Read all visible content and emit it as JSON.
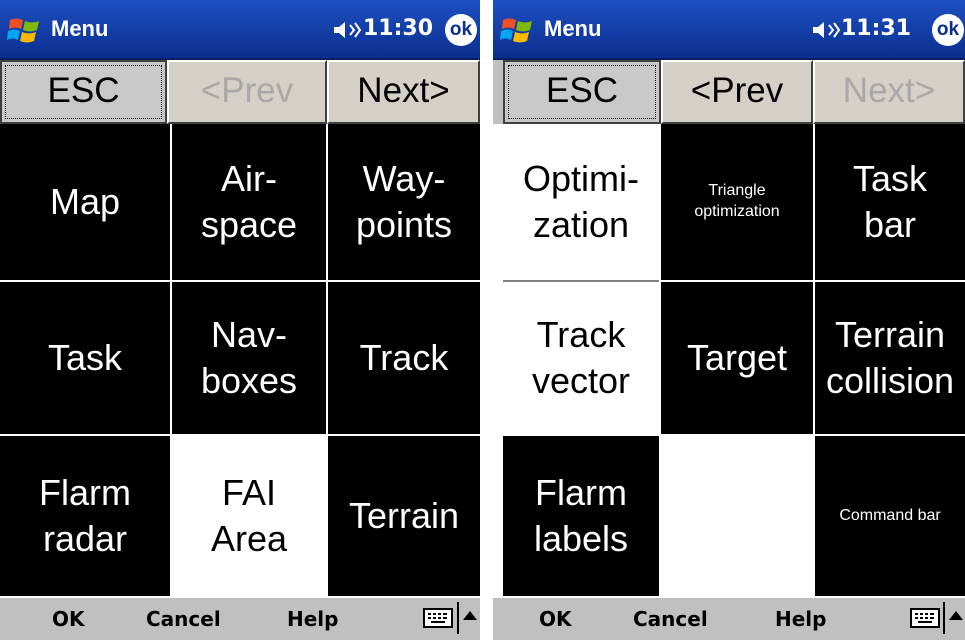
{
  "screens": [
    {
      "title": "Menu",
      "time": "11:30",
      "ok": "ok",
      "nav": {
        "esc": "ESC",
        "prev": "<Prev",
        "next": "Next>"
      },
      "cells": [
        "Map",
        "Air-\nspace",
        "Way-\npoints",
        "Task",
        "Nav-\nboxes",
        "Track",
        "Flarm\nradar",
        "FAI\nArea",
        "Terrain"
      ],
      "bottom": {
        "ok": "OK",
        "cancel": "Cancel",
        "help": "Help"
      }
    },
    {
      "title": "Menu",
      "time": "11:31",
      "ok": "ok",
      "nav": {
        "esc": "ESC",
        "prev": "<Prev",
        "next": "Next>"
      },
      "cells": [
        "Optimi-\nzation",
        "Triangle\noptimization",
        "Task\nbar",
        "Track\nvector",
        "Target",
        "Terrain\ncollision",
        "Flarm\nlabels",
        "",
        "Command bar"
      ],
      "bottom": {
        "ok": "OK",
        "cancel": "Cancel",
        "help": "Help"
      }
    }
  ],
  "colors": {
    "titlebar": "#0b2f8e",
    "button_face": "#d4d0c8",
    "cell_dark": "#000000",
    "cell_light": "#ffffff"
  },
  "icons": [
    "windows-logo-icon",
    "speaker-icon",
    "keyboard-icon",
    "arrow-up-icon"
  ]
}
